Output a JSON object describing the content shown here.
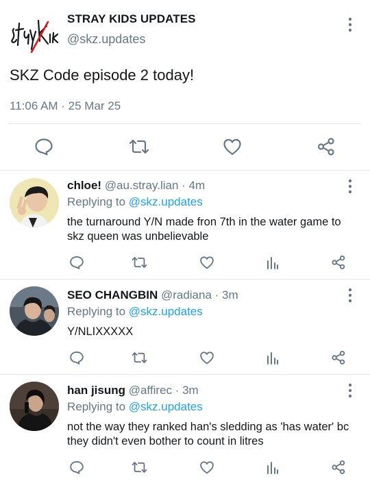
{
  "main_tweet": {
    "author_name": "STRAY KIDS UPDATES",
    "author_handle": "@skz.updates",
    "logo_text": "StrayKids",
    "text": "SKZ Code episode 2 today!",
    "timestamp": "11:06 AM · 25 Mar 25",
    "actions": [
      "reply-icon",
      "retweet-icon",
      "like-icon",
      "share-icon"
    ]
  },
  "replies": [
    {
      "name": "chloe!",
      "handle": "@au.stray.lian",
      "time": "4m",
      "meta": " @au.stray.lian · 4m",
      "replying_prefix": "Replying to ",
      "replying_to": "@skz.updates",
      "text": "the turnaround Y/N made fron 7th in the water game to skz queen was unbelievable"
    },
    {
      "name": "SEO CHANGBIN",
      "handle": "@radiana",
      "time": "3m",
      "meta": " @radiana · 3m",
      "replying_prefix": "Replying to ",
      "replying_to": "@skz.updates",
      "text": "Y/NLIXXXXX"
    },
    {
      "name": "han jisung",
      "handle": "@affirec",
      "time": "3m",
      "meta": " @affirec · 3m",
      "replying_prefix": "Replying to ",
      "replying_to": "@skz.updates",
      "text": "not the way they ranked han's sledding as 'has water' bc they didn't even bother to count in litres"
    }
  ],
  "colors": {
    "text": "#14171a",
    "secondary": "#657786",
    "mention": "#1da1f2",
    "divider": "#e1e8ed",
    "logo_accent": "#e0161e"
  }
}
